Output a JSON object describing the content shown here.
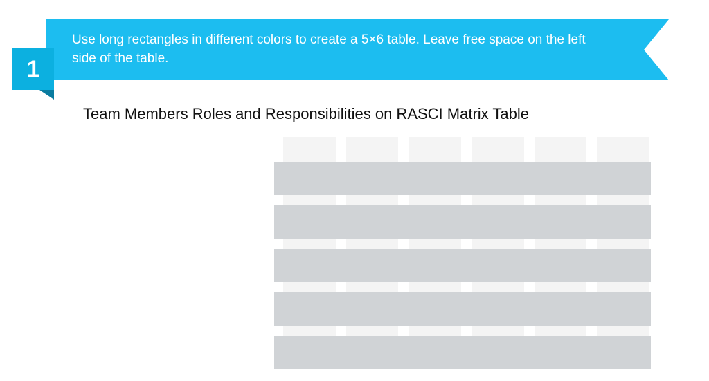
{
  "step": {
    "number": "1",
    "instruction": "Use long rectangles in different colors to create a 5×6 table. Leave free space on the left side of the table."
  },
  "title": "Team Members Roles and Responsibilities on RASCI Matrix Table",
  "table": {
    "columns": 6,
    "rows": 5
  }
}
